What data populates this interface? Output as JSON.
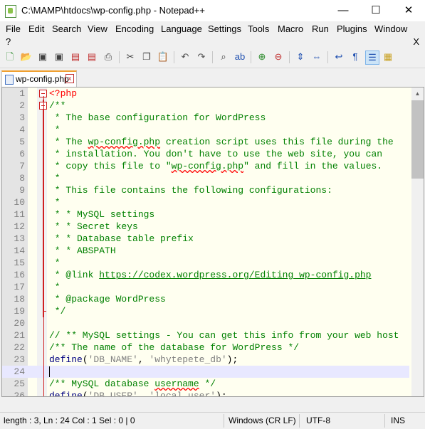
{
  "window": {
    "title": "C:\\MAMP\\htdocs\\wp-config.php - Notepad++",
    "minimize": "—",
    "maximize": "☐",
    "close": "✕"
  },
  "menu": {
    "items": [
      "File",
      "Edit",
      "Search",
      "View",
      "Encoding",
      "Language",
      "Settings",
      "Tools",
      "Macro",
      "Run",
      "Plugins",
      "Window"
    ],
    "help": "?",
    "close_doc": "X"
  },
  "toolbar": {
    "icons": [
      "new-file-icon",
      "open-file-icon",
      "save-icon",
      "save-all-icon",
      "close-icon",
      "close-all-icon",
      "print-icon",
      "cut-icon",
      "copy-icon",
      "paste-icon",
      "undo-icon",
      "redo-icon",
      "find-icon",
      "replace-icon",
      "zoom-in-icon",
      "zoom-out-icon",
      "sync-vertical-icon",
      "sync-horizontal-icon",
      "word-wrap-icon",
      "show-all-chars-icon",
      "indent-guide-icon",
      "document-map-icon"
    ]
  },
  "tab": {
    "label": "wp-config.php",
    "close": "x"
  },
  "editor": {
    "current_line": 24,
    "lines": [
      {
        "n": "1",
        "text": "<?php",
        "style": "php"
      },
      {
        "n": "2",
        "text": "/**",
        "style": "comment"
      },
      {
        "n": "3",
        "text": " * The base configuration for WordPress",
        "style": "comment"
      },
      {
        "n": "4",
        "text": " *",
        "style": "comment"
      },
      {
        "n": "5",
        "text": " * The wp-config.php creation script uses this file during the",
        "style": "comment"
      },
      {
        "n": "6",
        "text": " * installation. You don't have to use the web site, you can",
        "style": "comment"
      },
      {
        "n": "7",
        "text": " * copy this file to \"wp-config.php\" and fill in the values.",
        "style": "comment"
      },
      {
        "n": "8",
        "text": " *",
        "style": "comment"
      },
      {
        "n": "9",
        "text": " * This file contains the following configurations:",
        "style": "comment"
      },
      {
        "n": "10",
        "text": " *",
        "style": "comment"
      },
      {
        "n": "11",
        "text": " * * MySQL settings",
        "style": "comment"
      },
      {
        "n": "12",
        "text": " * * Secret keys",
        "style": "comment"
      },
      {
        "n": "13",
        "text": " * * Database table prefix",
        "style": "comment"
      },
      {
        "n": "14",
        "text": " * * ABSPATH",
        "style": "comment"
      },
      {
        "n": "15",
        "text": " *",
        "style": "comment"
      },
      {
        "n": "16",
        "text": " * @link https://codex.wordpress.org/Editing_wp-config.php",
        "style": "comment"
      },
      {
        "n": "17",
        "text": " *",
        "style": "comment"
      },
      {
        "n": "18",
        "text": " * @package WordPress",
        "style": "comment"
      },
      {
        "n": "19",
        "text": " */",
        "style": "comment"
      },
      {
        "n": "20",
        "text": "",
        "style": "plain"
      },
      {
        "n": "21",
        "text": "// ** MySQL settings - You can get this info from your web host",
        "style": "comment"
      },
      {
        "n": "22",
        "text": "/** The name of the database for WordPress */",
        "style": "comment"
      },
      {
        "n": "23",
        "text": "define('DB_NAME', 'whytepete_db');",
        "style": "code"
      },
      {
        "n": "24",
        "text": "",
        "style": "plain"
      },
      {
        "n": "25",
        "text": "/** MySQL database username */",
        "style": "comment"
      },
      {
        "n": "26",
        "text": "define('DB_USER', 'local_user');",
        "style": "code"
      }
    ],
    "link_text": "https://codex.wordpress.org/Editing_wp-config.php"
  },
  "status": {
    "length": "length : 3,",
    "position": "Ln : 24    Col : 1    Sel : 0 | 0",
    "eol": "Windows (CR LF)",
    "encoding": "UTF-8",
    "mode": "INS"
  },
  "colors": {
    "php_tag": "#ff0000",
    "comment": "#008000",
    "keyword": "#000080",
    "string": "#808080",
    "current_line_bg": "#e8e8ff",
    "editor_bg": "#fffff0",
    "tab_accent": "#f0a030"
  }
}
